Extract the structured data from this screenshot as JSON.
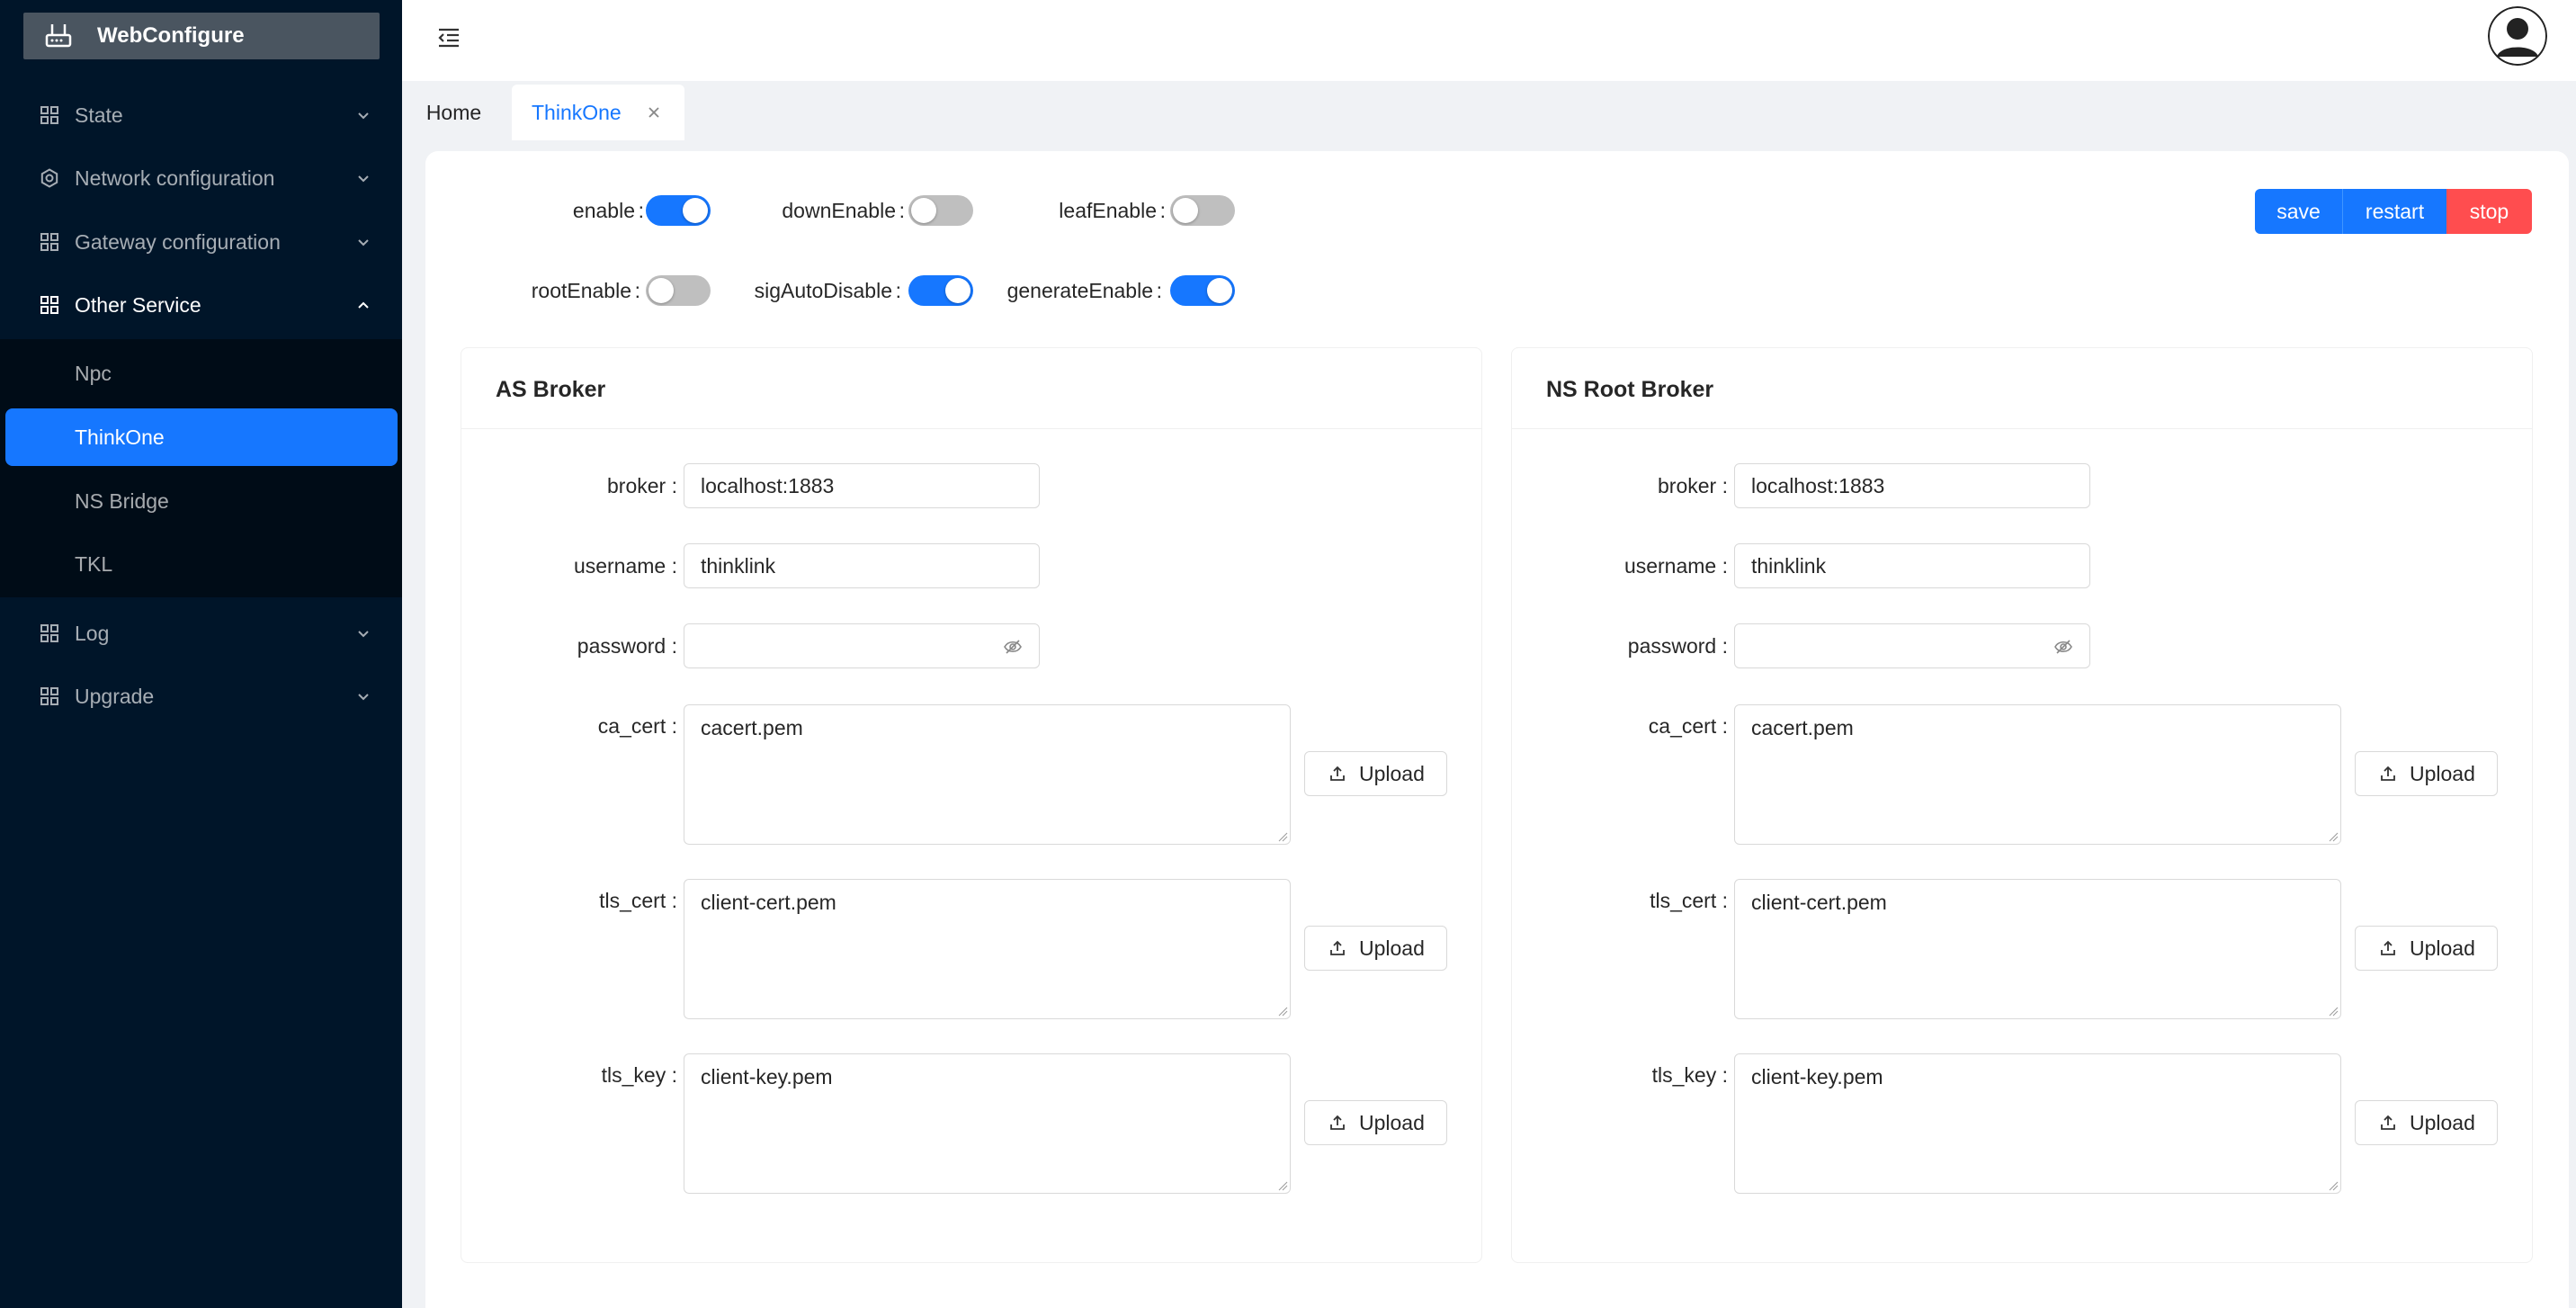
{
  "app": {
    "title": "WebConfigure"
  },
  "sidebar": {
    "items": [
      {
        "label": "State",
        "icon": "grid-icon",
        "arrow": "chevron-down-icon"
      },
      {
        "label": "Network configuration",
        "icon": "gear-icon",
        "arrow": "chevron-down-icon"
      },
      {
        "label": "Gateway configuration",
        "icon": "grid-icon",
        "arrow": "chevron-down-icon"
      },
      {
        "label": "Other Service",
        "icon": "grid-icon",
        "arrow": "chevron-up-icon"
      },
      {
        "label": "Log",
        "icon": "grid-icon",
        "arrow": "chevron-down-icon"
      },
      {
        "label": "Upgrade",
        "icon": "grid-icon",
        "arrow": "chevron-down-icon"
      }
    ],
    "submenu": [
      {
        "label": "Npc"
      },
      {
        "label": "ThinkOne",
        "active": true
      },
      {
        "label": "NS Bridge"
      },
      {
        "label": "TKL"
      }
    ],
    "accent": "#1677ff",
    "background": "#001529"
  },
  "tabs": [
    {
      "label": "Home"
    },
    {
      "label": "ThinkOne",
      "active": true
    }
  ],
  "switches": [
    {
      "label": "enable",
      "on": true
    },
    {
      "label": "downEnable",
      "on": false
    },
    {
      "label": "leafEnable",
      "on": false
    },
    {
      "label": "rootEnable",
      "on": false
    },
    {
      "label": "sigAutoDisable",
      "on": true
    },
    {
      "label": "generateEnable",
      "on": true
    }
  ],
  "actions": {
    "save": "save",
    "restart": "restart",
    "stop": "stop",
    "stop_color": "#ff4d4f"
  },
  "cards": [
    {
      "title": "AS Broker",
      "broker_label": "broker",
      "broker": "localhost:1883",
      "username_label": "username",
      "username": "thinklink",
      "password_label": "password",
      "password": "",
      "ca_cert_label": "ca_cert",
      "ca_cert": "cacert.pem",
      "tls_cert_label": "tls_cert",
      "tls_cert": "client-cert.pem",
      "tls_key_label": "tls_key",
      "tls_key": "client-key.pem",
      "upload_label": "Upload"
    },
    {
      "title": "NS Root Broker",
      "broker_label": "broker",
      "broker": "localhost:1883",
      "username_label": "username",
      "username": "thinklink",
      "password_label": "password",
      "password": "",
      "ca_cert_label": "ca_cert",
      "ca_cert": "cacert.pem",
      "tls_cert_label": "tls_cert",
      "tls_cert": "client-cert.pem",
      "tls_key_label": "tls_key",
      "tls_key": "client-key.pem",
      "upload_label": "Upload"
    }
  ]
}
